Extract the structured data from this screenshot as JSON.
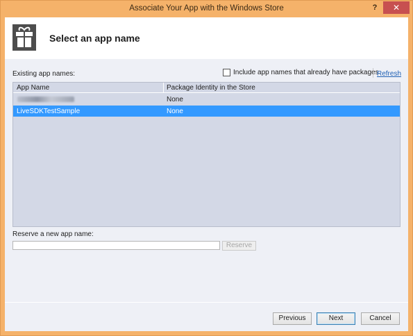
{
  "window": {
    "title": "Associate Your App with the Windows Store",
    "help_label": "?",
    "close_label": "✕"
  },
  "header": {
    "title": "Select an app name"
  },
  "existing": {
    "label": "Existing app names:",
    "include_label": "Include app names that already have packages",
    "include_checked": false,
    "refresh_label": "Refresh"
  },
  "grid": {
    "columns": [
      "App Name",
      "Package Identity in the Store"
    ],
    "rows": [
      {
        "name": "",
        "identity": "None",
        "selected": false,
        "name_obscured": true
      },
      {
        "name": "LiveSDKTestSample",
        "identity": "None",
        "selected": true
      }
    ]
  },
  "reserve": {
    "label": "Reserve a new app name:",
    "value": "",
    "button_label": "Reserve"
  },
  "buttons": {
    "previous": "Previous",
    "next": "Next",
    "cancel": "Cancel"
  },
  "colors": {
    "frame": "#f5b26a",
    "selection": "#3399ff",
    "grid_bg": "#d3d8e6",
    "link": "#1e5fb3"
  }
}
